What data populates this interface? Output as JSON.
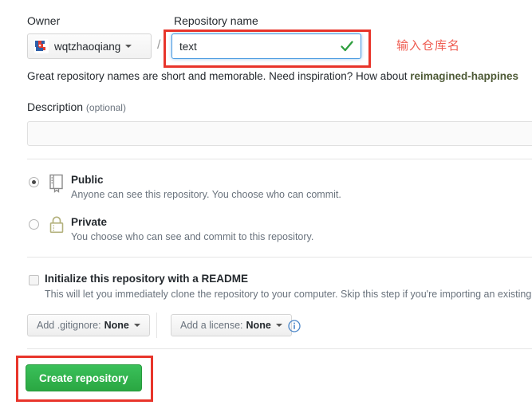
{
  "form": {
    "owner": {
      "label": "Owner",
      "value": "wqtzhaoqiang",
      "avatar_icon": "user-avatar-icon",
      "caret_icon": "chevron-down-icon"
    },
    "separator": "/",
    "repository_name": {
      "label": "Repository name",
      "value": "text",
      "placeholder": "",
      "valid_icon": "check-mark-icon"
    },
    "hint": {
      "text_before": "Great repository names are short and memorable. Need inspiration? How about ",
      "suggestion": "reimagined-happines"
    },
    "description": {
      "label": "Description",
      "optional": "(optional)",
      "value": "",
      "placeholder": ""
    },
    "visibility": {
      "options": [
        {
          "id": "public",
          "title": "Public",
          "description": "Anyone can see this repository. You choose who can commit.",
          "icon": "repo-book-icon",
          "selected": true
        },
        {
          "id": "private",
          "title": "Private",
          "description": "You choose who can see and commit to this repository.",
          "icon": "lock-icon",
          "selected": false
        }
      ]
    },
    "readme": {
      "title": "Initialize this repository with a README",
      "description": "This will let you immediately clone the repository to your computer. Skip this step if you're importing an existing rep",
      "checked": false
    },
    "gitignore": {
      "label": "Add .gitignore:",
      "value": "None",
      "caret_icon": "chevron-down-icon"
    },
    "license": {
      "label": "Add a license:",
      "value": "None",
      "caret_icon": "chevron-down-icon"
    },
    "info_icon": "info-circle-icon",
    "submit": {
      "label": "Create repository"
    }
  },
  "annotations": {
    "repo_name_note": "输入仓库名",
    "box_color": "#e8352b",
    "note_color": "#ef5d52"
  },
  "colors": {
    "accent_green": "#2aa742",
    "focus_blue": "#4a9ae1",
    "check_green": "#2e9e3e",
    "link_olive": "#4e5a36",
    "lock_olive": "#b3b17c",
    "muted_text": "#6a737d"
  }
}
